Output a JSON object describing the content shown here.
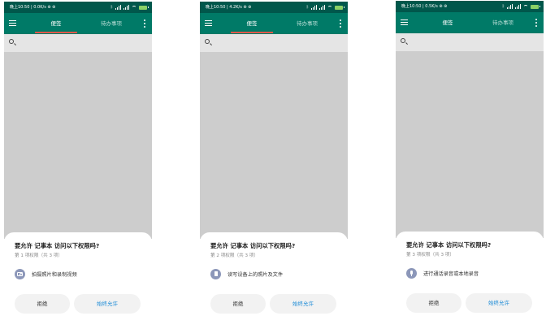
{
  "dialog_title": "要允许 记事本 访问以下权限吗?",
  "phones": [
    {
      "status_text": "晚上10:50 | 0.0K/s ⊛ ⊛",
      "tab_active": "便签",
      "tab_inactive": "待办事项",
      "step_text": "第 1 项权限（共 3 项）",
      "permission_icon": "camera-icon",
      "permission_label": "拍摄照片和录制视频",
      "deny_label": "拒绝",
      "allow_label": "始终允许"
    },
    {
      "status_text": "晚上10:50 | 4.2K/s ⊛ ⊛",
      "tab_active": "便签",
      "tab_inactive": "待办事项",
      "step_text": "第 2 项权限（共 3 项）",
      "permission_icon": "file-icon",
      "permission_label": "读写设备上的照片及文件",
      "deny_label": "拒绝",
      "allow_label": "始终允许"
    },
    {
      "status_text": "晚上10:50 | 0.5K/s ⊛ ⊛",
      "tab_active": "便签",
      "tab_inactive": "待办事项",
      "step_text": "第 3 项权限（共 3 项）",
      "permission_icon": "microphone-icon",
      "permission_label": "进行通话录音或本地录音",
      "deny_label": "拒绝",
      "allow_label": "始终允许"
    }
  ]
}
